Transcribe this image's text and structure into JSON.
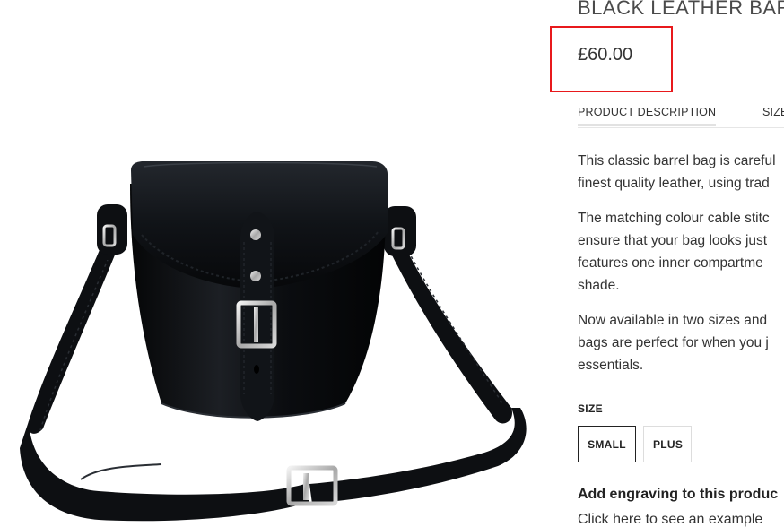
{
  "product": {
    "title": "BLACK LEATHER BARREL",
    "price": "£60.00"
  },
  "tabs": [
    {
      "label": "PRODUCT DESCRIPTION"
    },
    {
      "label": "SIZE"
    }
  ],
  "description": [
    {
      "line1": "This classic barrel bag is careful",
      "line2": "finest quality leather, using trad"
    },
    {
      "line1": "The matching colour cable stitc",
      "line2": "ensure that your bag looks just",
      "line3": "features one inner compartme",
      "line4": "shade."
    },
    {
      "line1": "Now available in two sizes and",
      "line2": "bags are perfect for when you j",
      "line3": "essentials."
    }
  ],
  "size": {
    "label": "SIZE",
    "options": [
      "SMALL",
      "PLUS"
    ],
    "selected": "SMALL"
  },
  "engraving": {
    "title": "Add engraving to this produc",
    "link": "Click here to see an example"
  },
  "colors": {
    "highlight_box": "#e8191c",
    "leather": "#0d0f12",
    "buckle": "#c9c9c9"
  }
}
